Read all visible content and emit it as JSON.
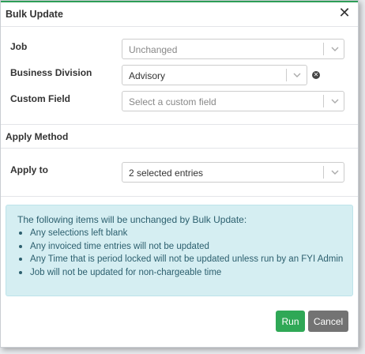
{
  "dialog": {
    "title": "Bulk Update",
    "close_glyph": "✕"
  },
  "fields": {
    "job": {
      "label": "Job",
      "value": "Unchanged"
    },
    "business_division": {
      "label": "Business Division",
      "value": "Advisory"
    },
    "custom_field": {
      "label": "Custom Field",
      "placeholder": "Select a custom field"
    }
  },
  "apply_method": {
    "section_title": "Apply Method",
    "apply_to": {
      "label": "Apply to",
      "value": "2 selected entries"
    }
  },
  "info": {
    "heading": "The following items will be unchanged by Bulk Update:",
    "items": [
      "Any selections left blank",
      "Any invoiced time entries will not be updated",
      "Any Time that is period locked will not be updated unless run by an FYI Admin",
      "Job will not be updated for non-chargeable time"
    ]
  },
  "footer": {
    "run_label": "Run",
    "cancel_label": "Cancel"
  },
  "colors": {
    "accent": "#2e9e57",
    "run_button": "#2fa856",
    "cancel_button": "#737373",
    "info_background": "#d5eef2",
    "info_text": "#2c5f6e"
  },
  "icons": [
    "close-icon",
    "chevron-down-icon",
    "clear-icon",
    "bullet-icon"
  ]
}
